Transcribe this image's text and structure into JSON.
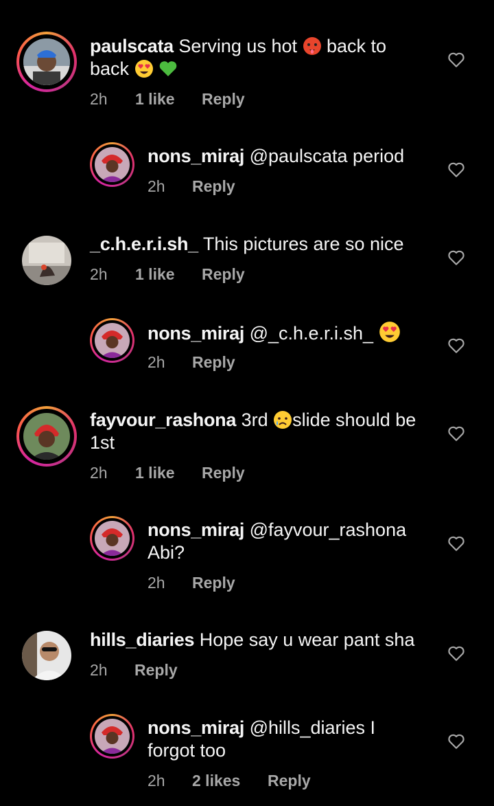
{
  "comments": [
    {
      "username": "paulscata",
      "text": "Serving us hot",
      "text2": "back to",
      "text3": "back",
      "emojis": [
        "hot-face-emoji",
        "heart-eyes-emoji",
        "green-heart-emoji"
      ],
      "time": "2h",
      "likes": "1 like",
      "reply": "Reply"
    },
    {
      "username": "nons_miraj",
      "text": "@paulscata period",
      "time": "2h",
      "reply": "Reply"
    },
    {
      "username": "_c.h.e.r.i.sh_",
      "text": "This pictures are so nice",
      "time": "2h",
      "likes": "1 like",
      "reply": "Reply"
    },
    {
      "username": "nons_miraj",
      "text": "@_c.h.e.r.i.sh_",
      "emojis": [
        "heart-eyes-emoji"
      ],
      "time": "2h",
      "reply": "Reply"
    },
    {
      "username": "fayvour_rashona",
      "text": "3rd",
      "text2": "slide should be",
      "text3": "1st",
      "emojis": [
        "crying-face-emoji"
      ],
      "time": "2h",
      "likes": "1 like",
      "reply": "Reply"
    },
    {
      "username": "nons_miraj",
      "text": "@fayvour_rashona",
      "text2": "Abi?",
      "time": "2h",
      "reply": "Reply"
    },
    {
      "username": "hills_diaries",
      "text": "Hope say u wear pant sha",
      "time": "2h",
      "reply": "Reply"
    },
    {
      "username": "nons_miraj",
      "text": "@hills_diaries I",
      "text2": "forgot too",
      "time": "2h",
      "likes": "2 likes",
      "reply": "Reply"
    }
  ],
  "colors": {
    "background": "#000000",
    "text": "#f5f5f5",
    "muted": "#a8a8a8"
  },
  "icons": {
    "like": "heart-outline-icon"
  }
}
